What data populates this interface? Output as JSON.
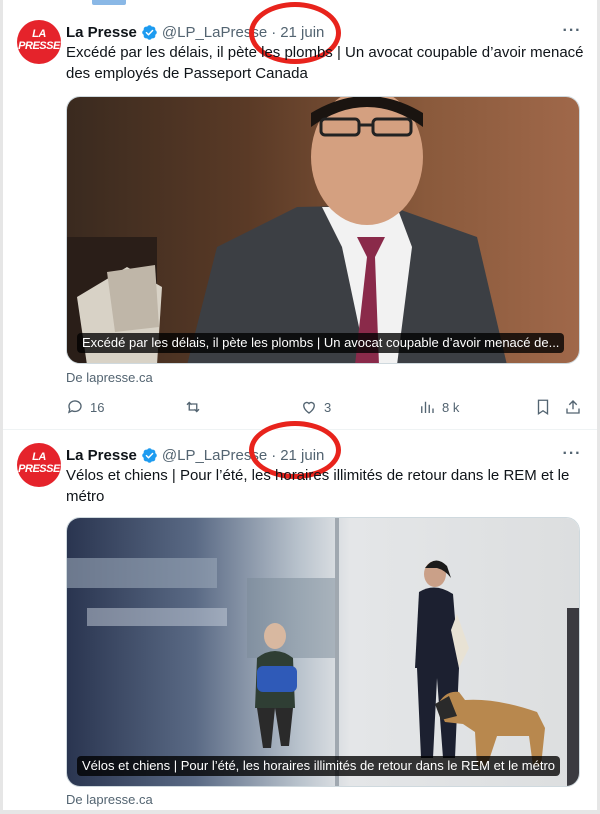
{
  "tweets": [
    {
      "author": {
        "name": "La Presse",
        "handle": "@LP_LaPresse",
        "avatar_line1": "LA",
        "avatar_line2": "PRESSE",
        "verified_icon": "verified-badge-icon"
      },
      "separator": "·",
      "date": "21 juin",
      "more_icon": "more-dots-icon",
      "text": "Excédé par les délais, il pète les plombs | Un avocat coupable d’avoir menacé des employés de Passeport Canada",
      "media": {
        "caption": "Excédé par les délais, il pète les plombs | Un avocat coupable d’avoir menacé de..."
      },
      "source": "De lapresse.ca",
      "actions": {
        "replies": "16",
        "retweets": "",
        "likes": "3",
        "views": "8 k"
      }
    },
    {
      "author": {
        "name": "La Presse",
        "handle": "@LP_LaPresse",
        "avatar_line1": "LA",
        "avatar_line2": "PRESSE",
        "verified_icon": "verified-badge-icon"
      },
      "separator": "·",
      "date": "21 juin",
      "more_icon": "more-dots-icon",
      "text": "Vélos et chiens | Pour l’été, les horaires illimités de retour dans le REM et le métro",
      "media": {
        "caption": "Vélos et chiens | Pour l’été, les horaires illimités de retour dans le REM et le métro"
      },
      "source": "De lapresse.ca"
    }
  ],
  "colors": {
    "brand": "#e5232b",
    "verified": "#1d9bf0",
    "highlight": "#e8231c",
    "muted": "#536471"
  }
}
